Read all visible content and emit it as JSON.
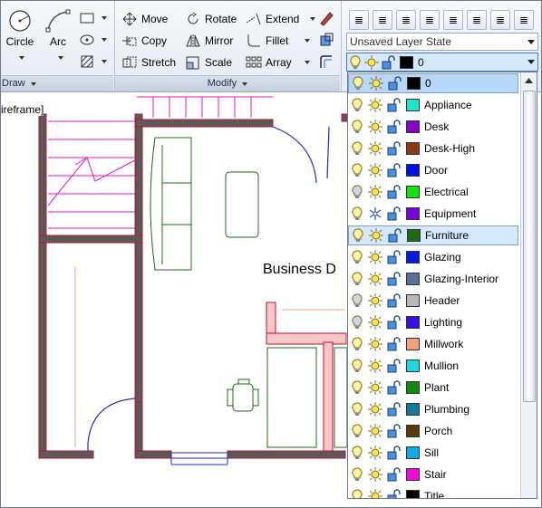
{
  "ribbon": {
    "draw_panel": {
      "title": "Draw",
      "circle_label": "Circle",
      "arc_label": "Arc"
    },
    "modify_panel": {
      "title": "Modify",
      "move_label": "Move",
      "rotate_label": "Rotate",
      "extend_label": "Extend",
      "copy_label": "Copy",
      "mirror_label": "Mirror",
      "fillet_label": "Fillet",
      "stretch_label": "Stretch",
      "scale_label": "Scale",
      "array_label": "Array"
    },
    "layers_panel": {
      "layer_state": "Unsaved Layer State",
      "current_layer": "0",
      "current_layer_color": "#000000"
    }
  },
  "viewport": {
    "visual_style_label": "ireframe]",
    "room_label": "Business D"
  },
  "layer_list": [
    {
      "name": "0",
      "color": "#000000",
      "on": true,
      "frozen": false,
      "selected": true
    },
    {
      "name": "Appliance",
      "color": "#22e5c8",
      "on": true,
      "frozen": false,
      "selected": false
    },
    {
      "name": "Desk",
      "color": "#8a00c8",
      "on": true,
      "frozen": false,
      "selected": false
    },
    {
      "name": "Desk-High",
      "color": "#8b3a14",
      "on": true,
      "frozen": false,
      "selected": false
    },
    {
      "name": "Door",
      "color": "#0010e0",
      "on": true,
      "frozen": false,
      "selected": false
    },
    {
      "name": "Electrical",
      "color": "#11e211",
      "on": false,
      "frozen": false,
      "selected": false
    },
    {
      "name": "Equipment",
      "color": "#7a00d8",
      "on": true,
      "frozen": true,
      "selected": false
    },
    {
      "name": "Furniture",
      "color": "#1c6a16",
      "on": true,
      "frozen": false,
      "selected": false,
      "hover": true
    },
    {
      "name": "Glazing",
      "color": "#0a1ad8",
      "on": true,
      "frozen": false,
      "selected": false
    },
    {
      "name": "Glazing-Interior",
      "color": "#5a6f96",
      "on": true,
      "frozen": false,
      "selected": false
    },
    {
      "name": "Header",
      "color": "#b8b8b8",
      "on": false,
      "frozen": false,
      "selected": false
    },
    {
      "name": "Lighting",
      "color": "#3a10e0",
      "on": false,
      "frozen": false,
      "selected": false
    },
    {
      "name": "Millwork",
      "color": "#f4a07e",
      "on": true,
      "frozen": false,
      "selected": false
    },
    {
      "name": "Mullion",
      "color": "#1ad8e0",
      "on": true,
      "frozen": false,
      "selected": false
    },
    {
      "name": "Plant",
      "color": "#12880c",
      "on": true,
      "frozen": false,
      "selected": false
    },
    {
      "name": "Plumbing",
      "color": "#157a94",
      "on": true,
      "frozen": false,
      "selected": false
    },
    {
      "name": "Porch",
      "color": "#5a3a0c",
      "on": true,
      "frozen": false,
      "selected": false
    },
    {
      "name": "Sill",
      "color": "#12a8e8",
      "on": true,
      "frozen": false,
      "selected": false
    },
    {
      "name": "Stair",
      "color": "#f00ad8",
      "on": true,
      "frozen": false,
      "selected": false
    },
    {
      "name": "Title",
      "color": "#000000",
      "on": true,
      "frozen": false,
      "selected": false
    }
  ]
}
